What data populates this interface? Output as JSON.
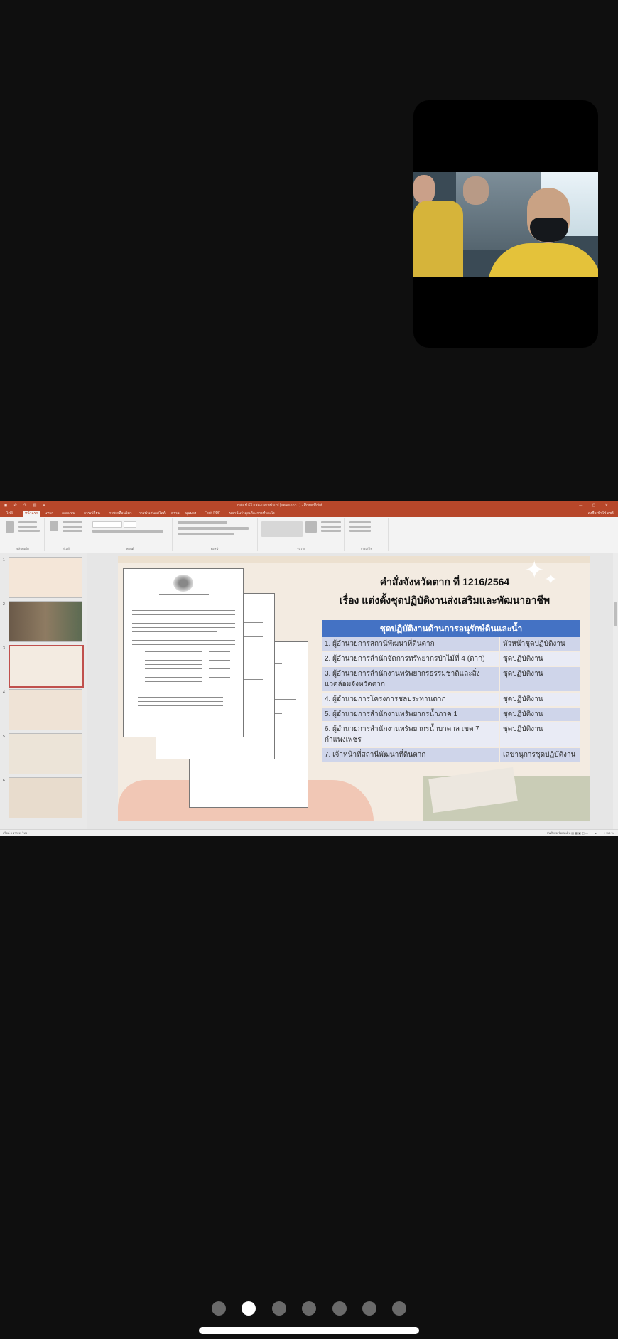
{
  "video": {
    "participant": "camera-feed"
  },
  "ppt": {
    "title": "...nสน.ป 63 แสดงเลขหน้าแป (แตคนอกา...) - PowerPoint",
    "quick_access": "◼ ↶ ↷ ▤ ▾",
    "window_controls": "— ▢ ✕",
    "tabs": [
      "ไฟล์",
      "หน้าแรก",
      "แทรก",
      "ออกแบบ",
      "การเปลี่ยน",
      "ภาพเคลื่อนไหว",
      "การนำเสนอสไลด์",
      "ตรวจ",
      "มุมมอง",
      "Foxit PDF",
      "บอกฉันว่าคุณต้องการทำอะไร"
    ],
    "account": "ลงชื่อเข้าใช้  แชร์",
    "ribbon_groups": [
      "คลิปบอร์ด",
      "สไลด์",
      "ฟอนต์",
      "ย่อหน้า",
      "รูปวาด",
      "การแก้ไข"
    ],
    "thumb_numbers": [
      "1",
      "2",
      "3",
      "4",
      "5",
      "6"
    ],
    "status_left": "สไลด์ 3 จาก 11   ไทย",
    "status_right": "บันทึกย่อ   ข้อคิดเห็น   ▤ ▦ ▣ ◫   — ───●─── +  113 %"
  },
  "slide": {
    "title_line1": "คำสั่งจังหวัดตาก ที่ 1216/2564",
    "title_line2": "เรื่อง แต่งตั้งชุดปฏิบัติงานส่งเสริมและพัฒนาอาชีพ",
    "table_header": "ชุดปฏิบัติงานด้านการอนุรักษ์ดินและน้ำ",
    "rows": [
      {
        "left": "1. ผู้อำนวยการสถานีพัฒนาที่ดินตาก",
        "right": "หัวหน้าชุดปฏิบัติงาน"
      },
      {
        "left": "2. ผู้อำนวยการสำนักจัดการทรัพยากรป่าไม้ที่ 4 (ตาก)",
        "right": "ชุดปฏิบัติงาน"
      },
      {
        "left": "3. ผู้อำนวยการสำนักงานทรัพยากรธรรมชาติและสิ่งแวดล้อมจังหวัดตาก",
        "right": "ชุดปฏิบัติงาน"
      },
      {
        "left": "4. ผู้อำนวยการโครงการชลประทานตาก",
        "right": "ชุดปฏิบัติงาน"
      },
      {
        "left": "5. ผู้อำนวยการสำนักงานทรัพยากรน้ำภาค 1",
        "right": "ชุดปฏิบัติงาน"
      },
      {
        "left": "6. ผู้อำนวยการสำนักงานทรัพยากรน้ำบาดาล เขต 7 กำแพงเพชร",
        "right": "ชุดปฏิบัติงาน"
      },
      {
        "left": "7. เจ้าหน้าที่สถานีพัฒนาที่ดินตาก",
        "right": "เลขานุการชุดปฏิบัติงาน"
      }
    ]
  },
  "pager": {
    "count": 7,
    "active_index": 1
  }
}
